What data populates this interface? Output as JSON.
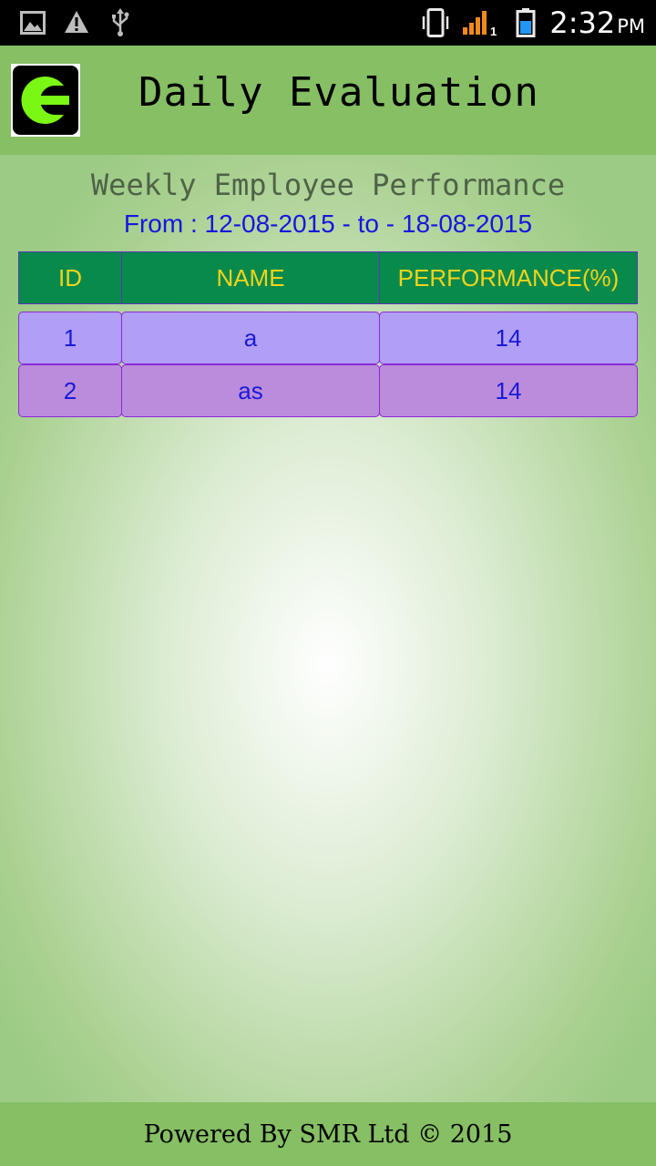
{
  "status_bar": {
    "time": "2:32",
    "ampm": "PM",
    "signal_sim": "1",
    "icons": [
      "image-icon",
      "warning-icon",
      "usb-icon",
      "vibrate-icon",
      "signal-icon",
      "battery-icon"
    ],
    "signal_color": "#f08a1c",
    "battery_color": "#2196f3"
  },
  "header": {
    "title": "Daily Evaluation",
    "logo_letter": "E",
    "logo_color": "#7bf714"
  },
  "report": {
    "title": "Weekly Employee Performance",
    "from_label": "From :",
    "from_date": "12-08-2015",
    "separator": "- to -",
    "to_date": "18-08-2015"
  },
  "table": {
    "columns": [
      "ID",
      "NAME",
      "PERFORMANCE(%)"
    ],
    "rows": [
      [
        "1",
        "a",
        "14"
      ],
      [
        "2",
        "as",
        "14"
      ]
    ]
  },
  "footer": {
    "text": "Powered By SMR Ltd © 2015"
  }
}
